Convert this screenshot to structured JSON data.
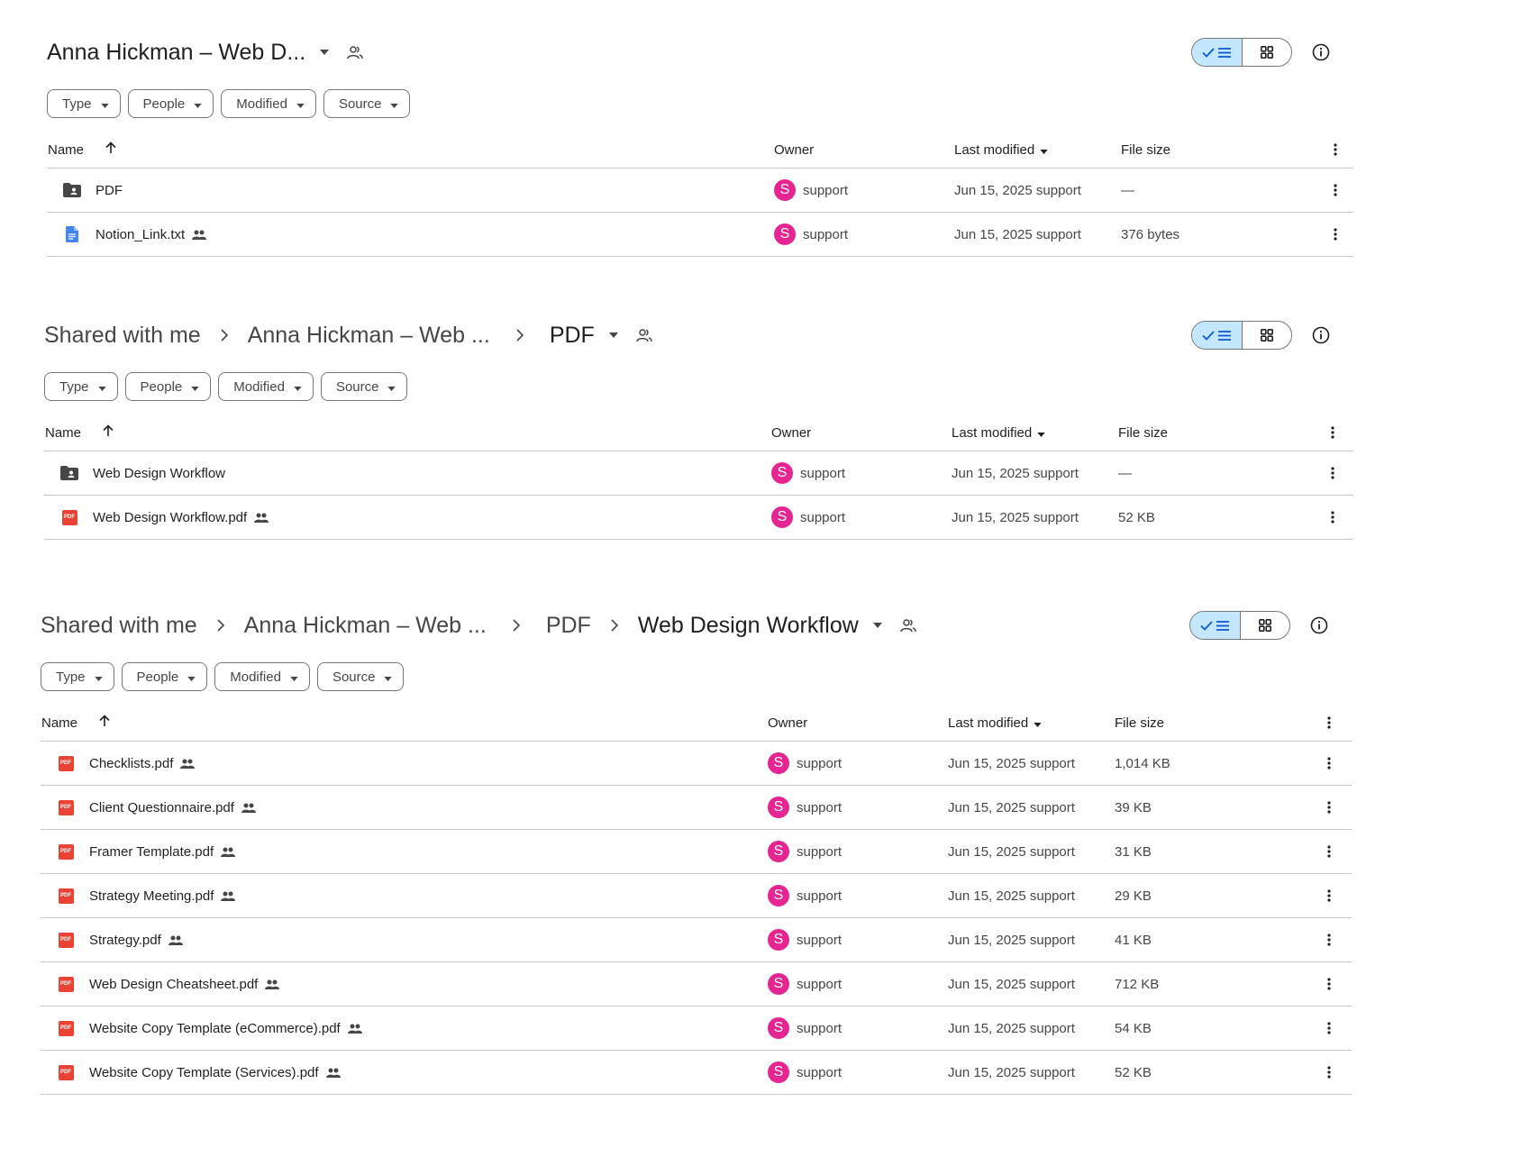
{
  "colors": {
    "accent": "#c2e7ff",
    "avatar": "#e52592",
    "pdf": "#ea4335",
    "doc": "#4285f4"
  },
  "panels": [
    {
      "breadcrumb": [
        {
          "label": "Anna Hickman – Web D..."
        }
      ],
      "filters": [
        "Type",
        "People",
        "Modified",
        "Source"
      ],
      "columns": {
        "name": "Name",
        "owner": "Owner",
        "modified": "Last modified",
        "size": "File size"
      },
      "rows": [
        {
          "icon": "shared-folder-icon",
          "name": "PDF",
          "shared": false,
          "owner_initial": "S",
          "owner": "support",
          "modified": "Jun 15, 2025 support",
          "size": "—"
        },
        {
          "icon": "doc-icon",
          "name": "Notion_Link.txt",
          "shared": true,
          "owner_initial": "S",
          "owner": "support",
          "modified": "Jun 15, 2025 support",
          "size": "376 bytes"
        }
      ]
    },
    {
      "breadcrumb": [
        {
          "label": "Shared with me"
        },
        {
          "label": "Anna Hickman – Web ..."
        },
        {
          "label": "PDF"
        }
      ],
      "filters": [
        "Type",
        "People",
        "Modified",
        "Source"
      ],
      "columns": {
        "name": "Name",
        "owner": "Owner",
        "modified": "Last modified",
        "size": "File size"
      },
      "rows": [
        {
          "icon": "shared-folder-icon",
          "name": "Web Design Workflow",
          "shared": false,
          "owner_initial": "S",
          "owner": "support",
          "modified": "Jun 15, 2025 support",
          "size": "—"
        },
        {
          "icon": "pdf-icon",
          "name": "Web Design Workflow.pdf",
          "shared": true,
          "owner_initial": "S",
          "owner": "support",
          "modified": "Jun 15, 2025 support",
          "size": "52 KB"
        }
      ]
    },
    {
      "breadcrumb": [
        {
          "label": "Shared with me"
        },
        {
          "label": "Anna Hickman – Web ..."
        },
        {
          "label": "PDF"
        },
        {
          "label": "Web Design Workflow"
        }
      ],
      "filters": [
        "Type",
        "People",
        "Modified",
        "Source"
      ],
      "columns": {
        "name": "Name",
        "owner": "Owner",
        "modified": "Last modified",
        "size": "File size"
      },
      "rows": [
        {
          "icon": "pdf-icon",
          "name": "Checklists.pdf",
          "shared": true,
          "owner_initial": "S",
          "owner": "support",
          "modified": "Jun 15, 2025 support",
          "size": "1,014 KB"
        },
        {
          "icon": "pdf-icon",
          "name": "Client Questionnaire.pdf",
          "shared": true,
          "owner_initial": "S",
          "owner": "support",
          "modified": "Jun 15, 2025 support",
          "size": "39 KB"
        },
        {
          "icon": "pdf-icon",
          "name": "Framer Template.pdf",
          "shared": true,
          "owner_initial": "S",
          "owner": "support",
          "modified": "Jun 15, 2025 support",
          "size": "31 KB"
        },
        {
          "icon": "pdf-icon",
          "name": "Strategy Meeting.pdf",
          "shared": true,
          "owner_initial": "S",
          "owner": "support",
          "modified": "Jun 15, 2025 support",
          "size": "29 KB"
        },
        {
          "icon": "pdf-icon",
          "name": "Strategy.pdf",
          "shared": true,
          "owner_initial": "S",
          "owner": "support",
          "modified": "Jun 15, 2025 support",
          "size": "41 KB"
        },
        {
          "icon": "pdf-icon",
          "name": "Web Design Cheatsheet.pdf",
          "shared": true,
          "owner_initial": "S",
          "owner": "support",
          "modified": "Jun 15, 2025 support",
          "size": "712 KB"
        },
        {
          "icon": "pdf-icon",
          "name": "Website Copy Template (eCommerce).pdf",
          "shared": true,
          "owner_initial": "S",
          "owner": "support",
          "modified": "Jun 15, 2025 support",
          "size": "54 KB"
        },
        {
          "icon": "pdf-icon",
          "name": "Website Copy Template (Services).pdf",
          "shared": true,
          "owner_initial": "S",
          "owner": "support",
          "modified": "Jun 15, 2025 support",
          "size": "52 KB"
        }
      ]
    }
  ],
  "pdf_icon_text": "PDF"
}
